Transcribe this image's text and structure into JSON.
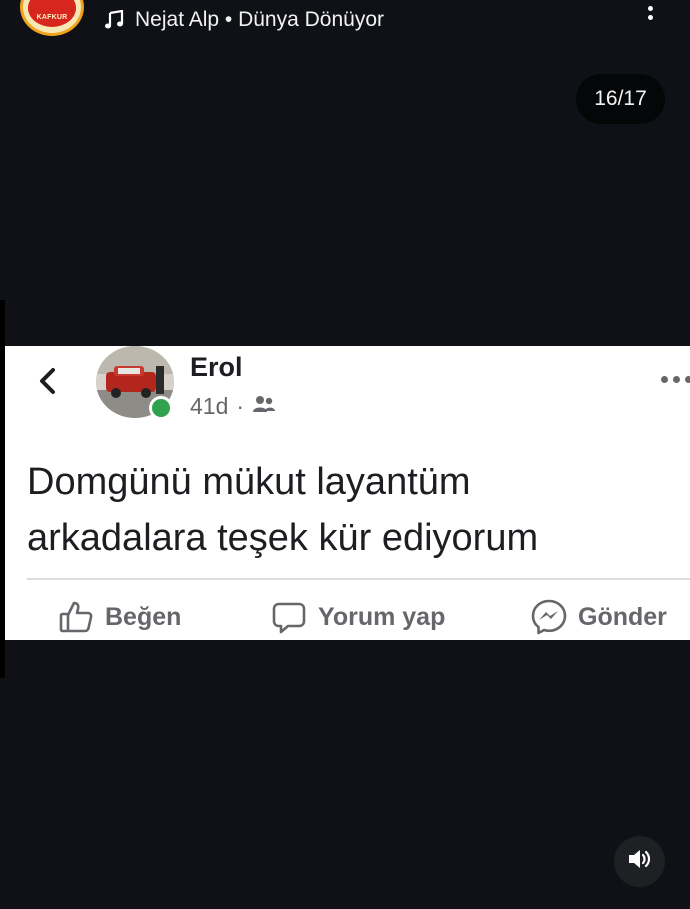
{
  "colors": {
    "background": "#0f1116",
    "story_ring": "#f0a31c",
    "online_dot": "#31a24c",
    "post_background": "#ffffff",
    "post_text": "#1c1e21",
    "muted_text": "#65676b"
  },
  "story": {
    "account_avatar_text": "KAFKUR",
    "music": {
      "icon": "music-note-icon",
      "label": "Nejat Alp • Dünya Dönüyor"
    },
    "more_icon": "more-vertical-icon",
    "counter": "16/17",
    "sound_icon": "speaker-icon"
  },
  "post": {
    "back_icon": "chevron-left-icon",
    "author": "Erol",
    "time": "41d",
    "separator": "·",
    "audience_icon": "friends-icon",
    "more_icon": "more-horizontal-icon",
    "text_line1": "Domgünü mükut layantüm",
    "text_line2": "arkadalara teşek kür ediyorum",
    "actions": {
      "like": "Beğen",
      "comment": "Yorum yap",
      "share": "Gönder"
    }
  }
}
